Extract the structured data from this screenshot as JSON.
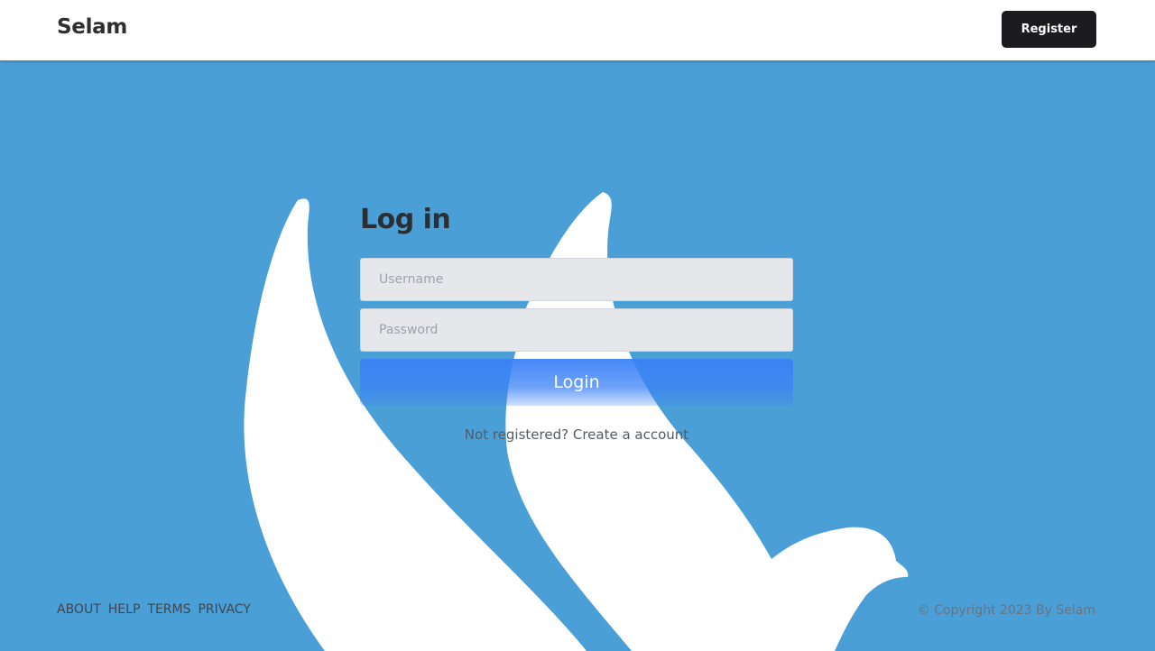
{
  "header": {
    "brand": "Selam",
    "register_label": "Register"
  },
  "login": {
    "title": "Log in",
    "username_placeholder": "Username",
    "password_placeholder": "Password",
    "submit_label": "Login",
    "signup_prompt": "Not registered?",
    "signup_link": "Create a account"
  },
  "footer": {
    "links": [
      "ABOUT",
      "HELP",
      "TERMS",
      "PRIVACY"
    ],
    "copyright": "© Copyright 2023 By Selam"
  },
  "colors": {
    "background": "#4a9fd6",
    "button_dark": "#1c1c1f",
    "accent_blue": "#3b82f6",
    "dove": "#ffffff"
  },
  "icons": {
    "background_art": "dove-illustration"
  }
}
